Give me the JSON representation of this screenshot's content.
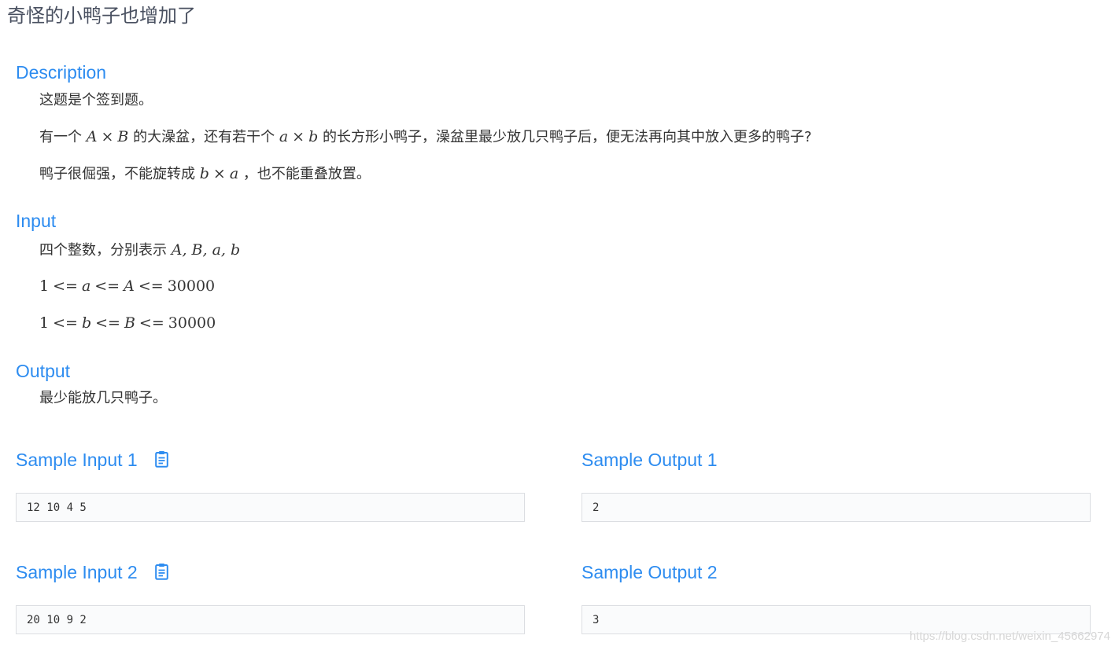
{
  "problem": {
    "title": "奇怪的小鸭子也增加了"
  },
  "description": {
    "heading": "Description",
    "line1": "这题是个签到题。",
    "line2": {
      "t1": "有一个",
      "A": "A",
      "times": "×",
      "B": "B",
      "t2": "的大澡盆，还有若干个",
      "a": "a",
      "b": "b",
      "t3": "的长方形小鸭子，澡盆里最少放几只鸭子后，便无法再向其中放入更多的鸭子?"
    },
    "line3": {
      "t1": "鸭子很倔强，不能旋转成",
      "b": "b",
      "times": "×",
      "a": "a",
      "t2": "，也不能重叠放置。"
    }
  },
  "input": {
    "heading": "Input",
    "line1": {
      "text": "四个整数，分别表示",
      "vars": "A, B, a, b"
    },
    "constraint1": {
      "one": "1",
      "le": "<=",
      "v1": "a",
      "v2": "A",
      "max": "30000"
    },
    "constraint2": {
      "one": "1",
      "le": "<=",
      "v1": "b",
      "v2": "B",
      "max": "30000"
    }
  },
  "output": {
    "heading": "Output",
    "line1": "最少能放几只鸭子。"
  },
  "samples": [
    {
      "input_label": "Sample Input 1",
      "input_value": "12 10 4 5",
      "output_label": "Sample Output 1",
      "output_value": "2"
    },
    {
      "input_label": "Sample Input 2",
      "input_value": "20 10 9 2",
      "output_label": "Sample Output 2",
      "output_value": "3"
    }
  ],
  "watermark": "https://blog.csdn.net/weixin_45662974",
  "colors": {
    "accent": "#2d8cf0",
    "text": "#333333",
    "border": "#dcdee2"
  },
  "icons": {
    "copy": "clipboard-icon"
  }
}
